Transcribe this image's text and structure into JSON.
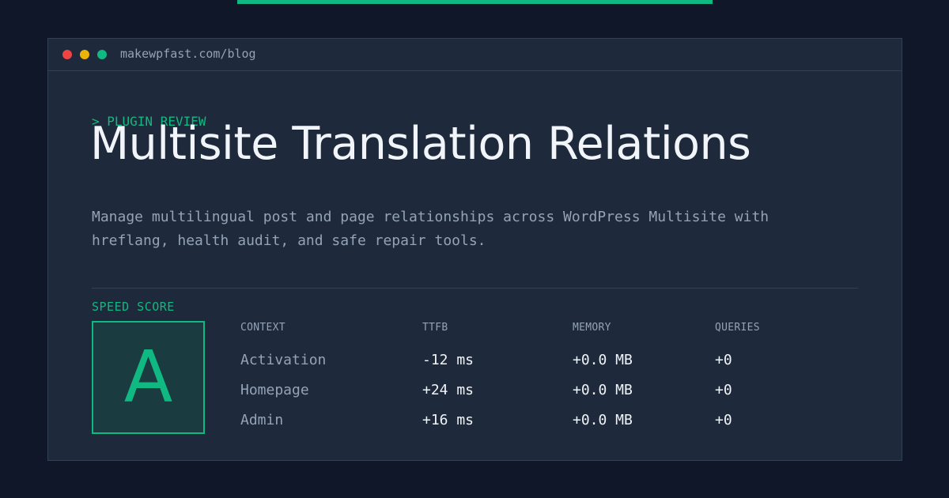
{
  "window": {
    "url": "makewpfast.com/blog"
  },
  "article": {
    "eyebrow": "> PLUGIN REVIEW",
    "title": "Multisite Translation Relations",
    "description": "Manage multilingual post and page relationships across WordPress Multisite with hreflang, health audit, and safe repair tools."
  },
  "score": {
    "label": "SPEED SCORE",
    "grade": "A"
  },
  "table": {
    "headers": {
      "context": "CONTEXT",
      "ttfb": "TTFB",
      "memory": "MEMORY",
      "queries": "QUERIES"
    },
    "rows": [
      {
        "context": "Activation",
        "ttfb": "-12 ms",
        "memory": "+0.0 MB",
        "queries": "+0"
      },
      {
        "context": "Homepage",
        "ttfb": "+24 ms",
        "memory": "+0.0 MB",
        "queries": "+0"
      },
      {
        "context": "Admin",
        "ttfb": "+16 ms",
        "memory": "+0.0 MB",
        "queries": "+0"
      }
    ]
  },
  "colors": {
    "background": "#0f1729",
    "panel": "#1e293b",
    "accent": "#10b981",
    "dot_red": "#ef4444",
    "dot_yellow": "#eab308",
    "dot_green": "#10b981"
  }
}
